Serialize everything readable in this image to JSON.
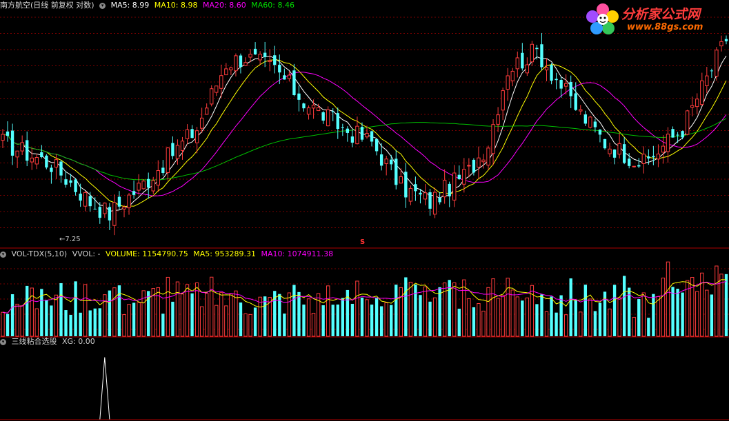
{
  "header": {
    "stock_title": "南方航空(日线 前复权 对数)",
    "ma5": "MA5: 8.99",
    "ma10": "MA10: 8.98",
    "ma20": "MA20: 8.60",
    "ma60": "MA60: 8.46"
  },
  "vol_header": {
    "title": "VOL-TDX(5,10)",
    "vvol": "VVOL: -",
    "volume": "VOLUME: 1154790.75",
    "ma5": "MA5: 953289.31",
    "ma10": "MA10: 1074911.38"
  },
  "xg_header": {
    "title": "三线粘合选股",
    "xg": "XG: 0.00"
  },
  "logo": {
    "title": "分析家公式网",
    "url": "www.88gs.com"
  },
  "annotations": {
    "low_label": "←7.25",
    "s_marker": "S"
  },
  "colors": {
    "up": "#ff3c3c",
    "down": "#54ffff",
    "ma5": "#ffffff",
    "ma10": "#ffff00",
    "ma20": "#ff00ff",
    "ma60": "#00c000",
    "grid": "#7a0000",
    "divider": "#b00000"
  },
  "chart_data": [
    {
      "type": "candlestick",
      "panel": "price",
      "scale": "log",
      "ylim": [
        7.1,
        10.4
      ],
      "candles_count": 150,
      "low_point": 7.25,
      "series": [
        {
          "name": "MA5",
          "last": 8.99
        },
        {
          "name": "MA10",
          "last": 8.98
        },
        {
          "name": "MA20",
          "last": 8.6
        },
        {
          "name": "MA60",
          "last": 8.46
        }
      ],
      "close_anchors": [
        [
          0,
          8.4
        ],
        [
          10,
          8.1
        ],
        [
          18,
          7.6
        ],
        [
          22,
          7.45
        ],
        [
          30,
          7.9
        ],
        [
          40,
          8.6
        ],
        [
          46,
          9.6
        ],
        [
          50,
          9.7
        ],
        [
          56,
          9.5
        ],
        [
          62,
          9.0
        ],
        [
          70,
          8.6
        ],
        [
          76,
          8.4
        ],
        [
          82,
          7.8
        ],
        [
          88,
          7.6
        ],
        [
          96,
          8.0
        ],
        [
          100,
          8.4
        ],
        [
          104,
          9.5
        ],
        [
          110,
          9.8
        ],
        [
          118,
          8.9
        ],
        [
          124,
          8.4
        ],
        [
          132,
          8.1
        ],
        [
          140,
          8.6
        ],
        [
          146,
          9.5
        ],
        [
          149,
          10.0
        ]
      ]
    },
    {
      "type": "bar",
      "panel": "volume",
      "series": [
        {
          "name": "VOLUME",
          "last": 1154790.75
        },
        {
          "name": "MA5",
          "last": 953289.31
        },
        {
          "name": "MA10",
          "last": 1074911.38
        }
      ]
    },
    {
      "type": "line",
      "panel": "indicator",
      "series": [
        {
          "name": "XG",
          "last": 0.0,
          "spike_index": 21,
          "spike_value": 1
        }
      ],
      "ylim": [
        0,
        1.15
      ]
    }
  ]
}
